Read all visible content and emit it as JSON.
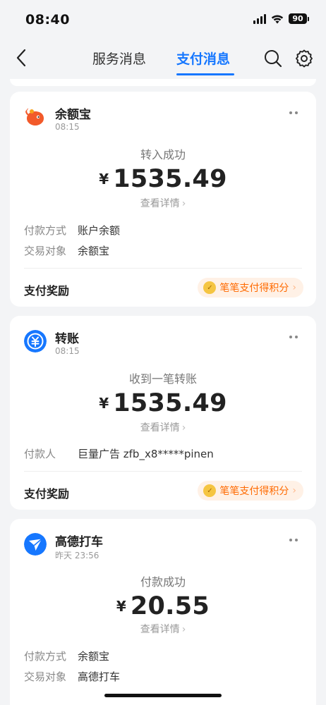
{
  "status_bar": {
    "time": "08:40",
    "battery": "90"
  },
  "nav": {
    "tabs": [
      {
        "label": "服务消息"
      },
      {
        "label": "支付消息"
      }
    ]
  },
  "colors": {
    "accent": "#1677ff",
    "reward_text": "#ff6a00"
  },
  "cards": [
    {
      "merchant": "余额宝",
      "time": "08:15",
      "status": "转入成功",
      "currency": "¥",
      "amount": "1535.49",
      "detail_link": "查看详情",
      "info": [
        {
          "label": "付款方式",
          "value": "账户余额"
        },
        {
          "label": "交易对象",
          "value": "余额宝"
        }
      ],
      "reward_label": "支付奖励",
      "reward_text": "笔笔支付得积分",
      "logo_icon": "yuebao-icon"
    },
    {
      "merchant": "转账",
      "time": "08:15",
      "status": "收到一笔转账",
      "currency": "¥",
      "amount": "1535.49",
      "detail_link": "查看详情",
      "info": [
        {
          "label": "付款人",
          "value": "巨量广告 zfb_x8*****pinen"
        }
      ],
      "reward_label": "支付奖励",
      "reward_text": "笔笔支付得积分",
      "logo_icon": "transfer-icon"
    },
    {
      "merchant": "高德打车",
      "time": "昨天 23:56",
      "status": "付款成功",
      "currency": "¥",
      "amount": "20.55",
      "detail_link": "查看详情",
      "info": [
        {
          "label": "付款方式",
          "value": "余额宝"
        },
        {
          "label": "交易对象",
          "value": "高德打车"
        }
      ],
      "logo_icon": "amap-icon"
    }
  ]
}
